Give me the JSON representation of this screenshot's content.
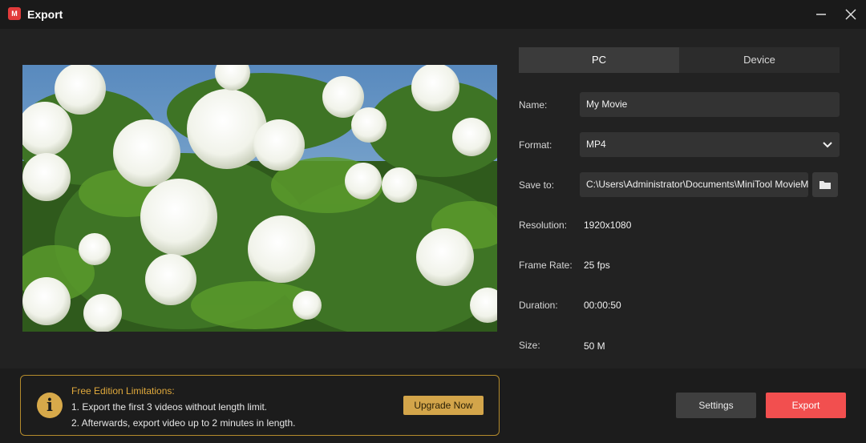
{
  "window": {
    "title": "Export",
    "logo_icon": "minitool-moviemaker-logo-icon",
    "logo_glyph": "M"
  },
  "tabs": [
    {
      "label": "PC",
      "active": true
    },
    {
      "label": "Device",
      "active": false
    }
  ],
  "fields": {
    "name": {
      "label": "Name:",
      "value": "My Movie"
    },
    "format": {
      "label": "Format:",
      "value": "MP4"
    },
    "save_to": {
      "label": "Save to:",
      "value": "C:\\Users\\Administrator\\Documents\\MiniTool MovieMaker\\output"
    },
    "resolution": {
      "label": "Resolution:",
      "value": "1920x1080"
    },
    "frame_rate": {
      "label": "Frame Rate:",
      "value": "25 fps"
    },
    "duration": {
      "label": "Duration:",
      "value": "00:00:50"
    },
    "size": {
      "label": "Size:",
      "value": "50 M"
    }
  },
  "limitations": {
    "title": "Free Edition Limitations:",
    "line1": "1. Export the first 3 videos without length limit.",
    "line2": "2. Afterwards, export video up to 2 minutes in length.",
    "icon": "info-icon",
    "icon_glyph": "i",
    "upgrade_label": "Upgrade Now"
  },
  "buttons": {
    "settings_label": "Settings",
    "export_label": "Export"
  },
  "colors": {
    "accent_export": "#f24f4f",
    "warning_gold": "#d3a54a"
  }
}
